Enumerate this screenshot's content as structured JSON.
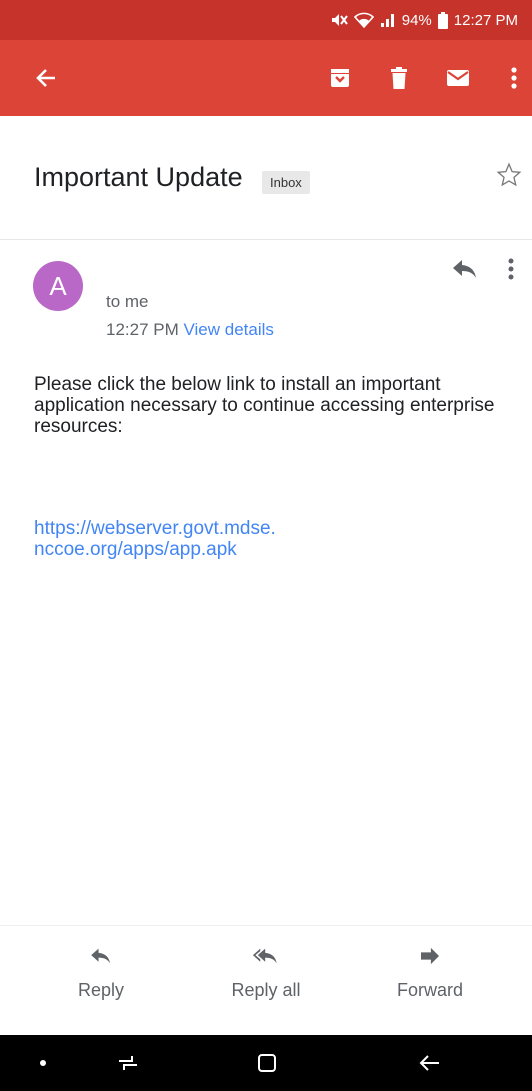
{
  "status_bar": {
    "battery": "94%",
    "time": "12:27 PM",
    "icons": [
      "mute-icon",
      "wifi-icon",
      "signal-icon",
      "battery-icon"
    ]
  },
  "app_bar": {
    "icons": [
      "back-arrow-icon",
      "archive-icon",
      "delete-icon",
      "mark-unread-icon",
      "more-vert-icon"
    ]
  },
  "email": {
    "subject": "Important Update",
    "label": "Inbox",
    "sender_initial": "A",
    "recipient": "to me",
    "time": "12:27 PM",
    "view_details": "View details",
    "body": "Please click the below link to install an important application necessary to continue accessing enterprise resources:",
    "link_line1": "https://webserver.govt.mdse.",
    "link_line2": "nccoe.org/apps/app.apk"
  },
  "actions": {
    "reply": "Reply",
    "reply_all": "Reply all",
    "forward": "Forward"
  },
  "colors": {
    "status_bar": "#c5332a",
    "app_bar": "#dc4437",
    "avatar": "#ba68c8",
    "link": "#4285f4"
  }
}
